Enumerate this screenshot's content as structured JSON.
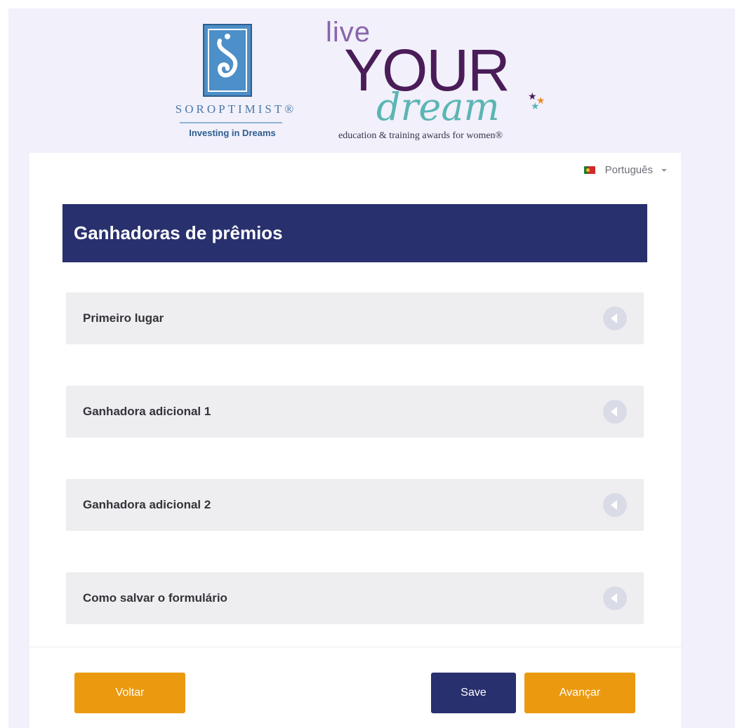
{
  "header": {
    "soroptimist": {
      "name": "SOROPTIMIST®",
      "tagline": "Investing in Dreams"
    },
    "live_your_dream": {
      "live": "live",
      "your": "YOUR",
      "dream": "dream",
      "tagline": "education & training awards for women®"
    }
  },
  "language": {
    "label": "Português",
    "flag": "portugal-flag"
  },
  "section": {
    "title": "Ganhadoras de prêmios"
  },
  "accordion": [
    {
      "label": "Primeiro lugar",
      "icon": "chevron-left-icon"
    },
    {
      "label": "Ganhadora adicional 1",
      "icon": "chevron-left-icon"
    },
    {
      "label": "Ganhadora adicional 2",
      "icon": "chevron-left-icon"
    },
    {
      "label": "Como salvar o formulário",
      "icon": "chevron-left-icon"
    }
  ],
  "buttons": {
    "back": "Voltar",
    "save": "Save",
    "next": "Avançar"
  },
  "colors": {
    "navy": "#29306e",
    "orange": "#eb9a10",
    "panel": "#eeeef1",
    "page_bg": "#f1f0fb"
  }
}
